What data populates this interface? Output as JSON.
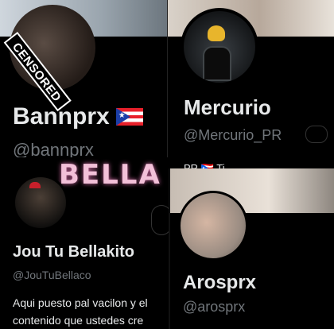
{
  "cards": [
    {
      "name": "Bannprx",
      "handle": "@bannprx",
      "censor_label": "CENSORED"
    },
    {
      "name": "Mercurio",
      "handle": "@Mercurio_PR",
      "bio_peek": "PR 🇵🇷 Ti"
    },
    {
      "name": "Jou Tu Bellakito",
      "handle": "@JouTuBellaco",
      "banner_text": "BELLA",
      "bio_line1": "Aqui puesto pal vacilon y el",
      "bio_line2": "contenido que ustedes cre"
    },
    {
      "name": "Arosprx",
      "handle": "@arosprx"
    }
  ],
  "icons": {
    "flag": "puerto-rico-flag-icon"
  },
  "colors": {
    "background": "#000000",
    "name_text": "#e7e9ea",
    "handle_text": "#71767b"
  }
}
